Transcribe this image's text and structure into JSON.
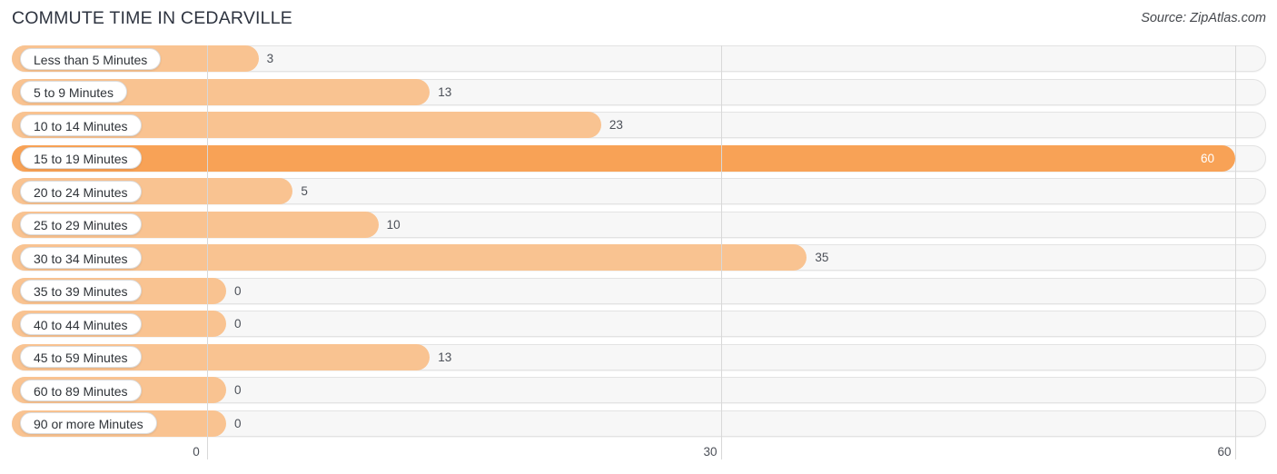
{
  "header": {
    "title": "COMMUTE TIME IN CEDARVILLE",
    "source": "Source: ZipAtlas.com"
  },
  "colors": {
    "bar_normal": "#f9c391",
    "bar_highlight": "#f8a256",
    "track": "#f7f7f7",
    "track_border": "#e3e3e3",
    "gridline": "#d8d8d8",
    "text": "#4c5058",
    "title": "#2e3440",
    "value_inside": "#ffffff"
  },
  "chart_data": {
    "type": "bar",
    "orientation": "horizontal",
    "title": "COMMUTE TIME IN CEDARVILLE",
    "xlabel": "",
    "ylabel": "",
    "xlim": [
      0,
      60
    ],
    "grid": true,
    "legend": null,
    "xticks": [
      0,
      30,
      60
    ],
    "xtick_labels": [
      "0",
      "30",
      "60"
    ],
    "categories": [
      "Less than 5 Minutes",
      "5 to 9 Minutes",
      "10 to 14 Minutes",
      "15 to 19 Minutes",
      "20 to 24 Minutes",
      "25 to 29 Minutes",
      "30 to 34 Minutes",
      "35 to 39 Minutes",
      "40 to 44 Minutes",
      "45 to 59 Minutes",
      "60 to 89 Minutes",
      "90 or more Minutes"
    ],
    "values": [
      3,
      13,
      23,
      60,
      5,
      10,
      35,
      0,
      0,
      13,
      0,
      0
    ],
    "value_labels": [
      "3",
      "13",
      "23",
      "60",
      "5",
      "10",
      "35",
      "0",
      "0",
      "13",
      "0",
      "0"
    ],
    "highlight_index": 3
  }
}
